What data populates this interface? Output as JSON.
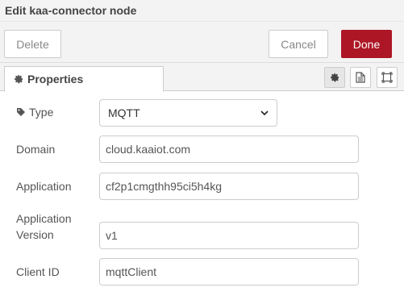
{
  "dialog": {
    "title": "Edit kaa-connector node"
  },
  "toolbar": {
    "delete_label": "Delete",
    "cancel_label": "Cancel",
    "done_label": "Done"
  },
  "tabs": {
    "properties_label": "Properties",
    "icons": [
      "gear-icon",
      "description-icon",
      "appearance-icon"
    ]
  },
  "form": {
    "type": {
      "label": "Type",
      "value": "MQTT",
      "icon": "tag-icon"
    },
    "domain": {
      "label": "Domain",
      "value": "cloud.kaaiot.com"
    },
    "application": {
      "label": "Application",
      "value": "cf2p1cmgthh95ci5h4kg"
    },
    "application_version": {
      "label_line1": "Application",
      "label_line2": "Version",
      "value": "v1"
    },
    "client_id": {
      "label": "Client ID",
      "value": "mqttClient"
    }
  },
  "colors": {
    "done_button": "#ad1625",
    "header_bg": "#f3f3f3",
    "border": "#cccccc"
  }
}
